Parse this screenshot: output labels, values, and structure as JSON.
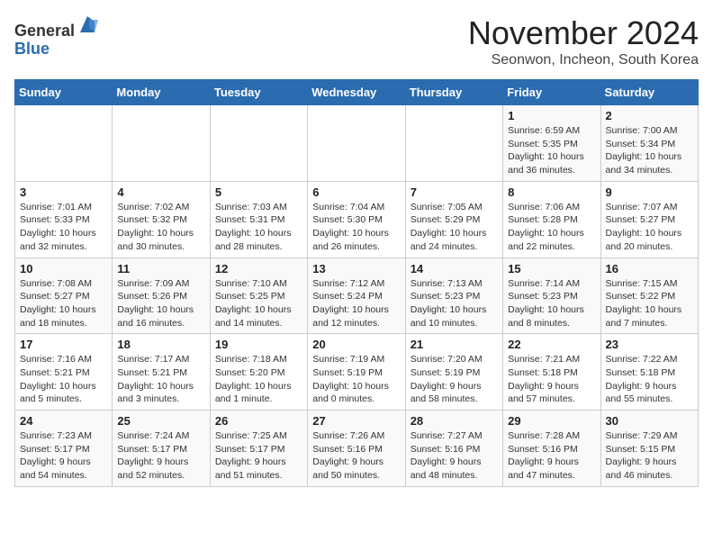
{
  "logo": {
    "line1": "General",
    "line2": "Blue"
  },
  "title": "November 2024",
  "location": "Seonwon, Incheon, South Korea",
  "days_of_week": [
    "Sunday",
    "Monday",
    "Tuesday",
    "Wednesday",
    "Thursday",
    "Friday",
    "Saturday"
  ],
  "weeks": [
    [
      {
        "day": "",
        "info": ""
      },
      {
        "day": "",
        "info": ""
      },
      {
        "day": "",
        "info": ""
      },
      {
        "day": "",
        "info": ""
      },
      {
        "day": "",
        "info": ""
      },
      {
        "day": "1",
        "info": "Sunrise: 6:59 AM\nSunset: 5:35 PM\nDaylight: 10 hours\nand 36 minutes."
      },
      {
        "day": "2",
        "info": "Sunrise: 7:00 AM\nSunset: 5:34 PM\nDaylight: 10 hours\nand 34 minutes."
      }
    ],
    [
      {
        "day": "3",
        "info": "Sunrise: 7:01 AM\nSunset: 5:33 PM\nDaylight: 10 hours\nand 32 minutes."
      },
      {
        "day": "4",
        "info": "Sunrise: 7:02 AM\nSunset: 5:32 PM\nDaylight: 10 hours\nand 30 minutes."
      },
      {
        "day": "5",
        "info": "Sunrise: 7:03 AM\nSunset: 5:31 PM\nDaylight: 10 hours\nand 28 minutes."
      },
      {
        "day": "6",
        "info": "Sunrise: 7:04 AM\nSunset: 5:30 PM\nDaylight: 10 hours\nand 26 minutes."
      },
      {
        "day": "7",
        "info": "Sunrise: 7:05 AM\nSunset: 5:29 PM\nDaylight: 10 hours\nand 24 minutes."
      },
      {
        "day": "8",
        "info": "Sunrise: 7:06 AM\nSunset: 5:28 PM\nDaylight: 10 hours\nand 22 minutes."
      },
      {
        "day": "9",
        "info": "Sunrise: 7:07 AM\nSunset: 5:27 PM\nDaylight: 10 hours\nand 20 minutes."
      }
    ],
    [
      {
        "day": "10",
        "info": "Sunrise: 7:08 AM\nSunset: 5:27 PM\nDaylight: 10 hours\nand 18 minutes."
      },
      {
        "day": "11",
        "info": "Sunrise: 7:09 AM\nSunset: 5:26 PM\nDaylight: 10 hours\nand 16 minutes."
      },
      {
        "day": "12",
        "info": "Sunrise: 7:10 AM\nSunset: 5:25 PM\nDaylight: 10 hours\nand 14 minutes."
      },
      {
        "day": "13",
        "info": "Sunrise: 7:12 AM\nSunset: 5:24 PM\nDaylight: 10 hours\nand 12 minutes."
      },
      {
        "day": "14",
        "info": "Sunrise: 7:13 AM\nSunset: 5:23 PM\nDaylight: 10 hours\nand 10 minutes."
      },
      {
        "day": "15",
        "info": "Sunrise: 7:14 AM\nSunset: 5:23 PM\nDaylight: 10 hours\nand 8 minutes."
      },
      {
        "day": "16",
        "info": "Sunrise: 7:15 AM\nSunset: 5:22 PM\nDaylight: 10 hours\nand 7 minutes."
      }
    ],
    [
      {
        "day": "17",
        "info": "Sunrise: 7:16 AM\nSunset: 5:21 PM\nDaylight: 10 hours\nand 5 minutes."
      },
      {
        "day": "18",
        "info": "Sunrise: 7:17 AM\nSunset: 5:21 PM\nDaylight: 10 hours\nand 3 minutes."
      },
      {
        "day": "19",
        "info": "Sunrise: 7:18 AM\nSunset: 5:20 PM\nDaylight: 10 hours\nand 1 minute."
      },
      {
        "day": "20",
        "info": "Sunrise: 7:19 AM\nSunset: 5:19 PM\nDaylight: 10 hours\nand 0 minutes."
      },
      {
        "day": "21",
        "info": "Sunrise: 7:20 AM\nSunset: 5:19 PM\nDaylight: 9 hours\nand 58 minutes."
      },
      {
        "day": "22",
        "info": "Sunrise: 7:21 AM\nSunset: 5:18 PM\nDaylight: 9 hours\nand 57 minutes."
      },
      {
        "day": "23",
        "info": "Sunrise: 7:22 AM\nSunset: 5:18 PM\nDaylight: 9 hours\nand 55 minutes."
      }
    ],
    [
      {
        "day": "24",
        "info": "Sunrise: 7:23 AM\nSunset: 5:17 PM\nDaylight: 9 hours\nand 54 minutes."
      },
      {
        "day": "25",
        "info": "Sunrise: 7:24 AM\nSunset: 5:17 PM\nDaylight: 9 hours\nand 52 minutes."
      },
      {
        "day": "26",
        "info": "Sunrise: 7:25 AM\nSunset: 5:17 PM\nDaylight: 9 hours\nand 51 minutes."
      },
      {
        "day": "27",
        "info": "Sunrise: 7:26 AM\nSunset: 5:16 PM\nDaylight: 9 hours\nand 50 minutes."
      },
      {
        "day": "28",
        "info": "Sunrise: 7:27 AM\nSunset: 5:16 PM\nDaylight: 9 hours\nand 48 minutes."
      },
      {
        "day": "29",
        "info": "Sunrise: 7:28 AM\nSunset: 5:16 PM\nDaylight: 9 hours\nand 47 minutes."
      },
      {
        "day": "30",
        "info": "Sunrise: 7:29 AM\nSunset: 5:15 PM\nDaylight: 9 hours\nand 46 minutes."
      }
    ]
  ]
}
